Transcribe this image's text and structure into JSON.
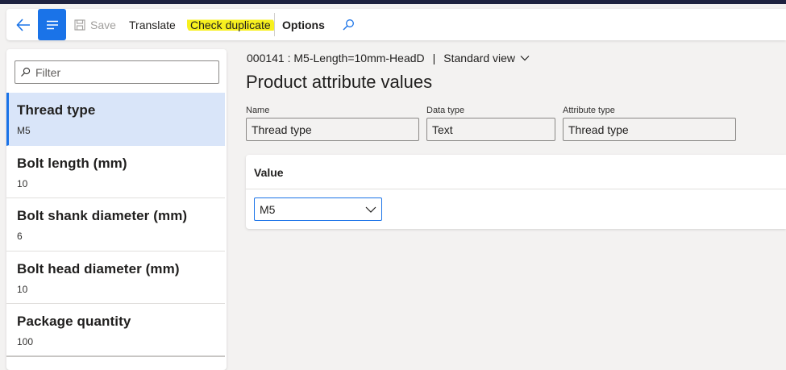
{
  "toolbar": {
    "save_label": "Save",
    "translate_label": "Translate",
    "check_duplicate_label": "Check duplicate",
    "options_label": "Options",
    "icons": [
      "back-arrow-icon",
      "menu-lines-icon",
      "save-disk-icon",
      "search-icon"
    ],
    "highlight_color": "#f7f01e",
    "accent": "#1a73e8"
  },
  "sidebar": {
    "filter_placeholder": "Filter",
    "items": [
      {
        "title": "Thread type",
        "value": "M5",
        "selected": true
      },
      {
        "title": "Bolt length (mm)",
        "value": "10"
      },
      {
        "title": "Bolt shank diameter (mm)",
        "value": "6"
      },
      {
        "title": "Bolt head diameter (mm)",
        "value": "10"
      },
      {
        "title": "Package quantity",
        "value": "100"
      }
    ]
  },
  "main": {
    "breadcrumb": {
      "record": "000141 : M5-Length=10mm-HeadD",
      "separator": "|",
      "view": "Standard view"
    },
    "title": "Product attribute values",
    "fields": {
      "name": {
        "label": "Name",
        "value": "Thread type"
      },
      "data_type": {
        "label": "Data type",
        "value": "Text"
      },
      "attribute_type": {
        "label": "Attribute type",
        "value": "Thread type"
      }
    },
    "value_section": {
      "header": "Value",
      "selected": "M5"
    }
  }
}
